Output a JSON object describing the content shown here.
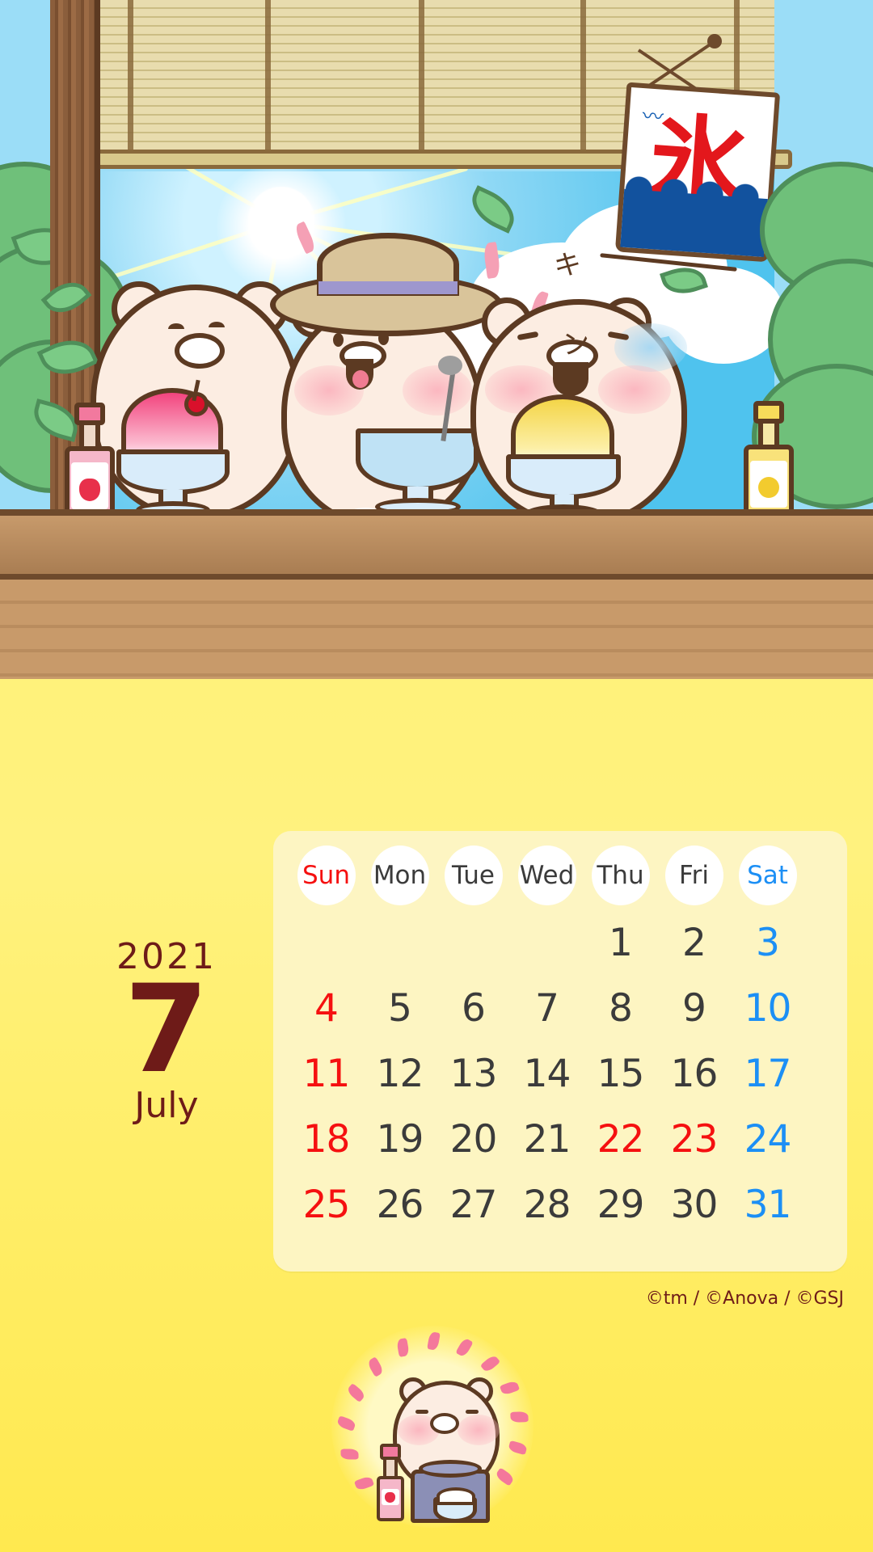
{
  "wallpaper": {
    "theme": "japanese-summer-kakigori",
    "background_color": "#FFF27A",
    "banner_text": "氷",
    "banner_label": "kakigori-ice-banner"
  },
  "month_block": {
    "year": "2021",
    "month_number": "7",
    "month_name": "July",
    "color": "#6E1B18"
  },
  "calendar": {
    "card_color": "#FDF5C2",
    "weekdays": [
      {
        "label": "Sun",
        "type": "sun"
      },
      {
        "label": "Mon",
        "type": "wk"
      },
      {
        "label": "Tue",
        "type": "wk"
      },
      {
        "label": "Wed",
        "type": "wk"
      },
      {
        "label": "Thu",
        "type": "wk"
      },
      {
        "label": "Fri",
        "type": "wk"
      },
      {
        "label": "Sat",
        "type": "sat"
      }
    ],
    "colors": {
      "weekday": "#3B3B3B",
      "sunday_holiday": "#F51010",
      "saturday": "#1C8FF5"
    },
    "leading_blanks": 4,
    "weeks": [
      [
        {
          "n": "",
          "c": "empty"
        },
        {
          "n": "",
          "c": "empty"
        },
        {
          "n": "",
          "c": "empty"
        },
        {
          "n": "",
          "c": "empty"
        },
        {
          "n": "1",
          "c": ""
        },
        {
          "n": "2",
          "c": ""
        },
        {
          "n": "3",
          "c": "blue"
        }
      ],
      [
        {
          "n": "4",
          "c": "red"
        },
        {
          "n": "5",
          "c": ""
        },
        {
          "n": "6",
          "c": ""
        },
        {
          "n": "7",
          "c": ""
        },
        {
          "n": "8",
          "c": ""
        },
        {
          "n": "9",
          "c": ""
        },
        {
          "n": "10",
          "c": "blue"
        }
      ],
      [
        {
          "n": "11",
          "c": "red"
        },
        {
          "n": "12",
          "c": ""
        },
        {
          "n": "13",
          "c": ""
        },
        {
          "n": "14",
          "c": ""
        },
        {
          "n": "15",
          "c": ""
        },
        {
          "n": "16",
          "c": ""
        },
        {
          "n": "17",
          "c": "blue"
        }
      ],
      [
        {
          "n": "18",
          "c": "red"
        },
        {
          "n": "19",
          "c": ""
        },
        {
          "n": "20",
          "c": ""
        },
        {
          "n": "21",
          "c": ""
        },
        {
          "n": "22",
          "c": "red"
        },
        {
          "n": "23",
          "c": "red"
        },
        {
          "n": "24",
          "c": "blue"
        }
      ],
      [
        {
          "n": "25",
          "c": "red"
        },
        {
          "n": "26",
          "c": ""
        },
        {
          "n": "27",
          "c": ""
        },
        {
          "n": "28",
          "c": ""
        },
        {
          "n": "29",
          "c": ""
        },
        {
          "n": "30",
          "c": ""
        },
        {
          "n": "31",
          "c": "blue"
        }
      ]
    ]
  },
  "credit": {
    "text": "©tm / ©Anova / ©GSJ"
  },
  "illustration": {
    "sound_effect": "キーン",
    "characters": [
      {
        "name": "bear-left",
        "holding": "strawberry-shaved-ice"
      },
      {
        "name": "bear-center",
        "holding": "empty-bowl",
        "wearing": "straw-hat"
      },
      {
        "name": "bear-right",
        "holding": "lemon-shaved-ice",
        "state": "brain-freeze"
      },
      {
        "name": "bear-mini",
        "holding": "shaved-ice-machine"
      }
    ],
    "props": [
      {
        "name": "strawberry-syrup-bottle",
        "color": "#F2799E"
      },
      {
        "name": "lemon-syrup-bottle",
        "color": "#F7DC5A"
      },
      {
        "name": "bamboo-blind",
        "color": "#E8DCAE"
      },
      {
        "name": "ice-banner",
        "color": "#E3171C"
      }
    ]
  }
}
